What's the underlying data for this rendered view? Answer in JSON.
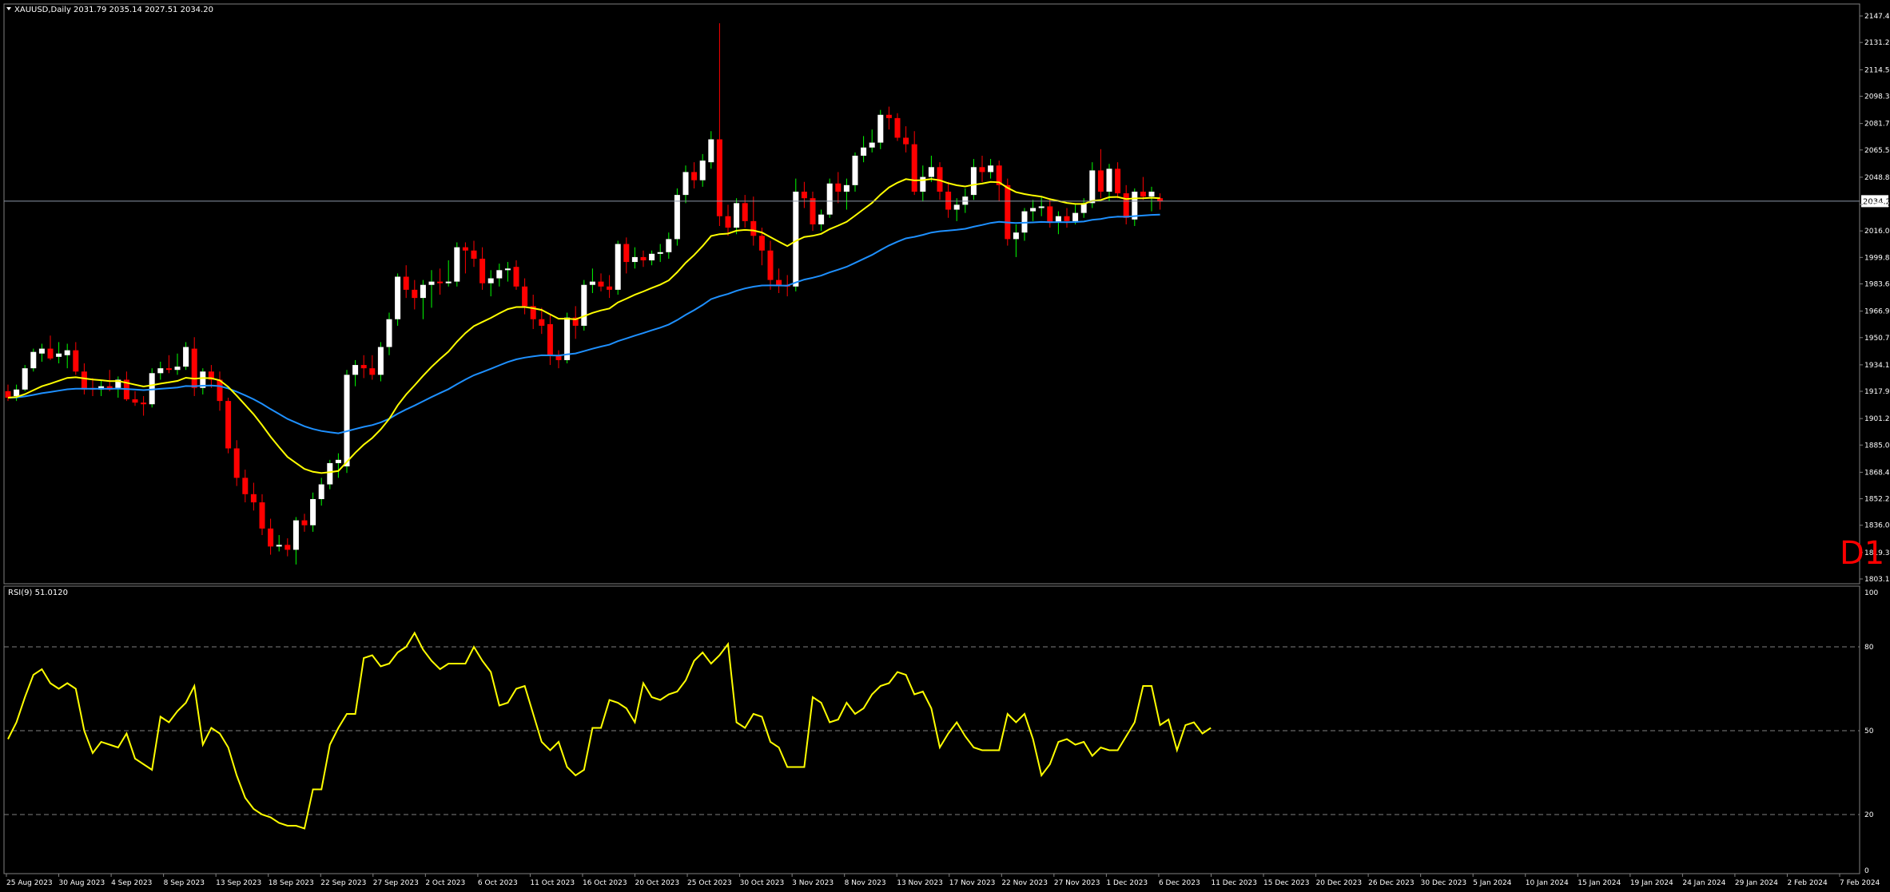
{
  "header": {
    "symbol": "XAUUSD,Daily",
    "ohlc": "2031.79 2035.14 2027.51 2034.20",
    "timeframe_badge": "D1"
  },
  "price_panel": {
    "y_ticks": [
      "2147.45",
      "2131.25",
      "2114.55",
      "2098.35",
      "2081.70",
      "2065.50",
      "2048.85",
      "2032.20",
      "2016.00",
      "1999.80",
      "1983.60",
      "1966.95",
      "1950.75",
      "1934.10",
      "1917.90",
      "1901.25",
      "1885.05",
      "1868.40",
      "1852.20",
      "1836.00",
      "1819.35",
      "1803.15"
    ],
    "current_price": "2034.20",
    "ylim": [
      1803.15,
      2147.45
    ]
  },
  "rsi_panel": {
    "label": "RSI(9) 51.0120",
    "y_ticks": [
      "100",
      "80",
      "50",
      "20",
      "0"
    ],
    "levels": [
      80,
      50,
      20
    ]
  },
  "x_axis": {
    "tick_labels": [
      "25 Aug 2023",
      "30 Aug 2023",
      "4 Sep 2023",
      "8 Sep 2023",
      "13 Sep 2023",
      "18 Sep 2023",
      "22 Sep 2023",
      "27 Sep 2023",
      "2 Oct 2023",
      "6 Oct 2023",
      "11 Oct 2023",
      "16 Oct 2023",
      "20 Oct 2023",
      "25 Oct 2023",
      "30 Oct 2023",
      "3 Nov 2023",
      "8 Nov 2023",
      "13 Nov 2023",
      "17 Nov 2023",
      "22 Nov 2023",
      "27 Nov 2023",
      "1 Dec 2023",
      "6 Dec 2023",
      "11 Dec 2023",
      "15 Dec 2023",
      "20 Dec 2023",
      "26 Dec 2023",
      "30 Dec 2023",
      "5 Jan 2024",
      "10 Jan 2024",
      "15 Jan 2024",
      "19 Jan 2024",
      "24 Jan 2024",
      "29 Jan 2024",
      "2 Feb 2024",
      "7 Feb 2024"
    ]
  },
  "colors": {
    "bull": "#ffffff",
    "bear": "#ff0000",
    "wick_up": "#00ff00",
    "ma_fast": "#ffff00",
    "ma_slow": "#1e90ff",
    "rsi": "#ffff00",
    "grid": "#808080",
    "badge": "#ff0000"
  },
  "chart_data": {
    "type": "candlestick",
    "symbol": "XAUUSD",
    "timeframe": "D1",
    "ohlc": [
      [
        1918,
        1922,
        1912,
        1914
      ],
      [
        1915,
        1922,
        1912,
        1919
      ],
      [
        1919,
        1934,
        1918,
        1932
      ],
      [
        1932,
        1944,
        1930,
        1942
      ],
      [
        1941,
        1947,
        1936,
        1944
      ],
      [
        1944,
        1952,
        1937,
        1938
      ],
      [
        1939,
        1948,
        1935,
        1941
      ],
      [
        1940,
        1947,
        1932,
        1943
      ],
      [
        1943,
        1948,
        1928,
        1930
      ],
      [
        1930,
        1935,
        1916,
        1919
      ],
      [
        1920,
        1926,
        1915,
        1919
      ],
      [
        1919,
        1925,
        1915,
        1921
      ],
      [
        1921,
        1931,
        1918,
        1919
      ],
      [
        1920,
        1927,
        1914,
        1925
      ],
      [
        1925,
        1930,
        1912,
        1913
      ],
      [
        1913,
        1918,
        1909,
        1911
      ],
      [
        1911,
        1915,
        1903,
        1910
      ],
      [
        1910,
        1932,
        1908,
        1929
      ],
      [
        1929,
        1936,
        1925,
        1932
      ],
      [
        1932,
        1940,
        1929,
        1931
      ],
      [
        1931,
        1941,
        1928,
        1933
      ],
      [
        1933,
        1948,
        1931,
        1945
      ],
      [
        1944,
        1951,
        1915,
        1920
      ],
      [
        1920,
        1932,
        1916,
        1930
      ],
      [
        1930,
        1934,
        1920,
        1925
      ],
      [
        1925,
        1930,
        1906,
        1912
      ],
      [
        1912,
        1914,
        1880,
        1883
      ],
      [
        1883,
        1888,
        1860,
        1865
      ],
      [
        1865,
        1870,
        1850,
        1855
      ],
      [
        1855,
        1862,
        1845,
        1850
      ],
      [
        1850,
        1855,
        1830,
        1834
      ],
      [
        1834,
        1840,
        1818,
        1823
      ],
      [
        1823,
        1830,
        1820,
        1824
      ],
      [
        1824,
        1828,
        1817,
        1821
      ],
      [
        1821,
        1841,
        1812,
        1839
      ],
      [
        1839,
        1843,
        1832,
        1836
      ],
      [
        1836,
        1856,
        1832,
        1852
      ],
      [
        1852,
        1865,
        1848,
        1861
      ],
      [
        1861,
        1876,
        1858,
        1874
      ],
      [
        1874,
        1880,
        1865,
        1876
      ],
      [
        1872,
        1931,
        1868,
        1928
      ],
      [
        1928,
        1937,
        1921,
        1934
      ],
      [
        1934,
        1940,
        1926,
        1932
      ],
      [
        1932,
        1940,
        1925,
        1928
      ],
      [
        1928,
        1948,
        1924,
        1945
      ],
      [
        1945,
        1966,
        1940,
        1962
      ],
      [
        1962,
        1990,
        1958,
        1988
      ],
      [
        1988,
        1995,
        1975,
        1980
      ],
      [
        1980,
        1986,
        1968,
        1975
      ],
      [
        1975,
        1986,
        1962,
        1983
      ],
      [
        1983,
        1992,
        1969,
        1985
      ],
      [
        1985,
        1993,
        1977,
        1984
      ],
      [
        1984,
        1998,
        1982,
        1985
      ],
      [
        1985,
        2009,
        1982,
        2006
      ],
      [
        2006,
        2009,
        1990,
        2004
      ],
      [
        2004,
        2010,
        1994,
        1999
      ],
      [
        1999,
        2006,
        1980,
        1984
      ],
      [
        1984,
        1992,
        1976,
        1987
      ],
      [
        1987,
        1996,
        1982,
        1992
      ],
      [
        1992,
        1997,
        1985,
        1993
      ],
      [
        1994,
        1998,
        1980,
        1982
      ],
      [
        1982,
        1987,
        1965,
        1970
      ],
      [
        1970,
        1977,
        1956,
        1962
      ],
      [
        1962,
        1969,
        1953,
        1958
      ],
      [
        1959,
        1965,
        1934,
        1940
      ],
      [
        1940,
        1943,
        1932,
        1937
      ],
      [
        1937,
        1966,
        1935,
        1963
      ],
      [
        1963,
        1970,
        1950,
        1958
      ],
      [
        1958,
        1986,
        1955,
        1983
      ],
      [
        1983,
        1993,
        1978,
        1985
      ],
      [
        1985,
        1990,
        1979,
        1982
      ],
      [
        1982,
        1989,
        1975,
        1980
      ],
      [
        1980,
        2010,
        1977,
        2008
      ],
      [
        2008,
        2012,
        1990,
        1997
      ],
      [
        1997,
        2006,
        1993,
        2000
      ],
      [
        2000,
        2004,
        1994,
        1998
      ],
      [
        1998,
        2004,
        1995,
        2002
      ],
      [
        2002,
        2008,
        1997,
        2003
      ],
      [
        2003,
        2015,
        1999,
        2011
      ],
      [
        2011,
        2042,
        2007,
        2038
      ],
      [
        2038,
        2056,
        2033,
        2052
      ],
      [
        2052,
        2058,
        2042,
        2047
      ],
      [
        2047,
        2063,
        2043,
        2059
      ],
      [
        2058,
        2077,
        2054,
        2072
      ],
      [
        2072,
        2143,
        2019,
        2025
      ],
      [
        2025,
        2032,
        2013,
        2018
      ],
      [
        2018,
        2036,
        2014,
        2033
      ],
      [
        2033,
        2038,
        2018,
        2022
      ],
      [
        2022,
        2037,
        2007,
        2013
      ],
      [
        2013,
        2018,
        1995,
        2004
      ],
      [
        2004,
        2010,
        1980,
        1986
      ],
      [
        1986,
        1993,
        1978,
        1983
      ],
      [
        1983,
        1989,
        1976,
        1982
      ],
      [
        1982,
        2048,
        1979,
        2040
      ],
      [
        2040,
        2046,
        2030,
        2036
      ],
      [
        2036,
        2040,
        2016,
        2020
      ],
      [
        2020,
        2029,
        2016,
        2026
      ],
      [
        2026,
        2048,
        2024,
        2045
      ],
      [
        2045,
        2052,
        2033,
        2040
      ],
      [
        2040,
        2048,
        2029,
        2044
      ],
      [
        2044,
        2064,
        2040,
        2062
      ],
      [
        2062,
        2074,
        2058,
        2067
      ],
      [
        2067,
        2078,
        2064,
        2070
      ],
      [
        2070,
        2090,
        2066,
        2087
      ],
      [
        2087,
        2092,
        2078,
        2085
      ],
      [
        2085,
        2088,
        2071,
        2073
      ],
      [
        2073,
        2080,
        2064,
        2069
      ],
      [
        2069,
        2077,
        2038,
        2040
      ],
      [
        2040,
        2056,
        2034,
        2049
      ],
      [
        2049,
        2062,
        2046,
        2055
      ],
      [
        2055,
        2058,
        2035,
        2040
      ],
      [
        2040,
        2046,
        2024,
        2029
      ],
      [
        2029,
        2036,
        2022,
        2032
      ],
      [
        2032,
        2042,
        2027,
        2037
      ],
      [
        2038,
        2060,
        2035,
        2055
      ],
      [
        2055,
        2062,
        2046,
        2052
      ],
      [
        2052,
        2060,
        2048,
        2056
      ],
      [
        2056,
        2059,
        2034,
        2044
      ],
      [
        2044,
        2048,
        2007,
        2011
      ],
      [
        2011,
        2020,
        2000,
        2015
      ],
      [
        2015,
        2030,
        2010,
        2028
      ],
      [
        2028,
        2035,
        2022,
        2030
      ],
      [
        2030,
        2037,
        2025,
        2031
      ],
      [
        2031,
        2036,
        2018,
        2021
      ],
      [
        2021,
        2028,
        2014,
        2025
      ],
      [
        2025,
        2030,
        2018,
        2022
      ],
      [
        2022,
        2032,
        2020,
        2027
      ],
      [
        2027,
        2036,
        2024,
        2033
      ],
      [
        2033,
        2058,
        2030,
        2053
      ],
      [
        2053,
        2066,
        2036,
        2040
      ],
      [
        2040,
        2057,
        2034,
        2054
      ],
      [
        2054,
        2058,
        2036,
        2039
      ],
      [
        2039,
        2044,
        2020,
        2024
      ],
      [
        2023,
        2042,
        2019,
        2040
      ],
      [
        2040,
        2049,
        2035,
        2037
      ],
      [
        2037,
        2043,
        2028,
        2040
      ],
      [
        2036,
        2039,
        2029,
        2034
      ]
    ],
    "ma_fast_last": 2036,
    "ma_slow_last": 2026,
    "rsi": [
      47,
      53,
      62,
      70,
      72,
      67,
      65,
      67,
      65,
      50,
      42,
      46,
      45,
      44,
      49,
      40,
      38,
      36,
      55,
      53,
      57,
      60,
      66,
      45,
      51,
      49,
      44,
      34,
      26,
      22,
      20,
      19,
      17,
      16,
      16,
      15,
      29,
      29,
      45,
      51,
      56,
      56,
      76,
      77,
      73,
      74,
      78,
      80,
      85,
      79,
      75,
      72,
      74,
      74,
      74,
      80,
      75,
      71,
      59,
      60,
      65,
      66,
      56,
      46,
      43,
      46,
      37,
      34,
      36,
      51,
      51,
      61,
      60,
      58,
      53,
      67,
      62,
      61,
      63,
      64,
      68,
      75,
      78,
      74,
      77,
      81,
      53,
      51,
      56,
      55,
      46,
      44,
      37,
      37,
      37,
      62,
      60,
      53,
      54,
      60,
      56,
      58,
      63,
      66,
      67,
      71,
      70,
      63,
      64,
      58,
      44,
      49,
      53,
      48,
      44,
      43,
      43,
      43,
      56,
      53,
      56,
      47,
      34,
      38,
      46,
      47,
      45,
      46,
      41,
      44,
      43,
      43,
      48,
      53,
      66,
      66,
      52,
      54,
      43,
      52,
      53,
      49,
      51
    ]
  }
}
